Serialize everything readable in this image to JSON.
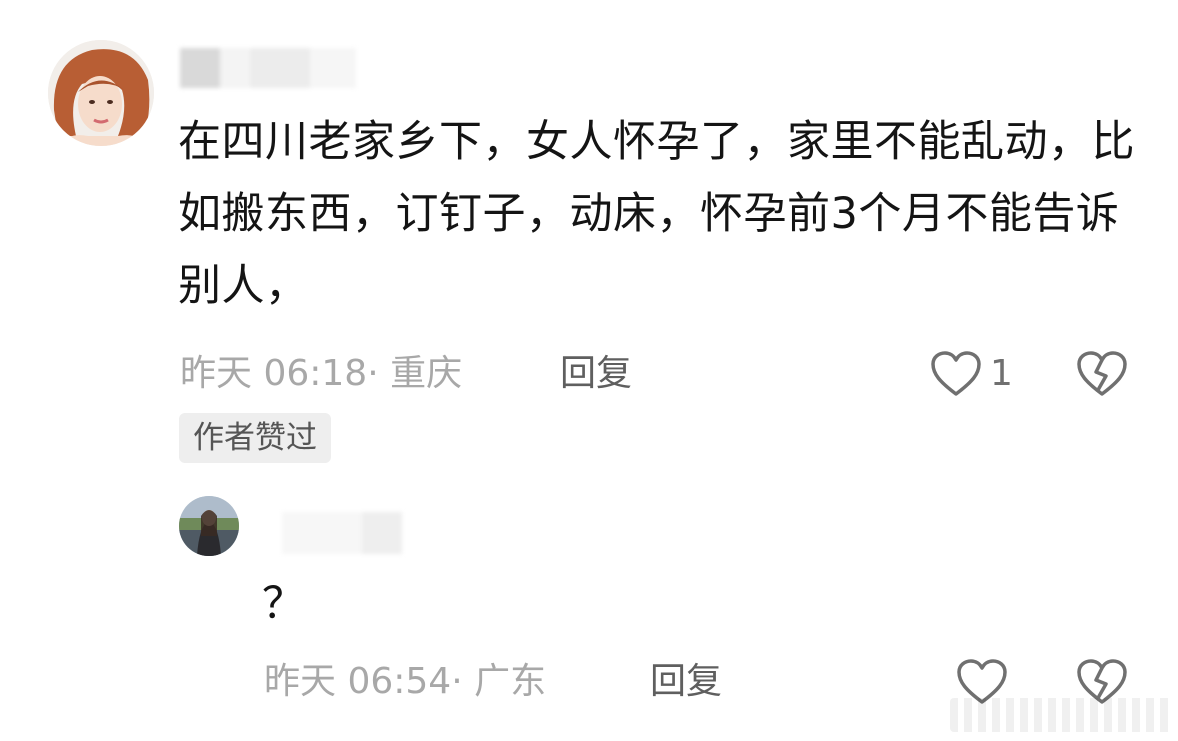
{
  "comment": {
    "text": "在四川老家乡下，女人怀孕了，家里不能乱动，比如搬东西，订钉子，动床，怀孕前3个月不能告诉别人，",
    "meta": "昨天 06:18· 重庆",
    "reply_label": "回复",
    "like_count": "1",
    "author_badge": "作者赞过"
  },
  "reply": {
    "text": "？",
    "meta": "昨天 06:54· 广东",
    "reply_label": "回复"
  },
  "icons": {
    "like": "heart-outline-icon",
    "dislike": "broken-heart-icon"
  },
  "colors": {
    "meta_text": "#a8a8a8",
    "icon_stroke": "#707070",
    "badge_bg": "#eeeeee"
  }
}
